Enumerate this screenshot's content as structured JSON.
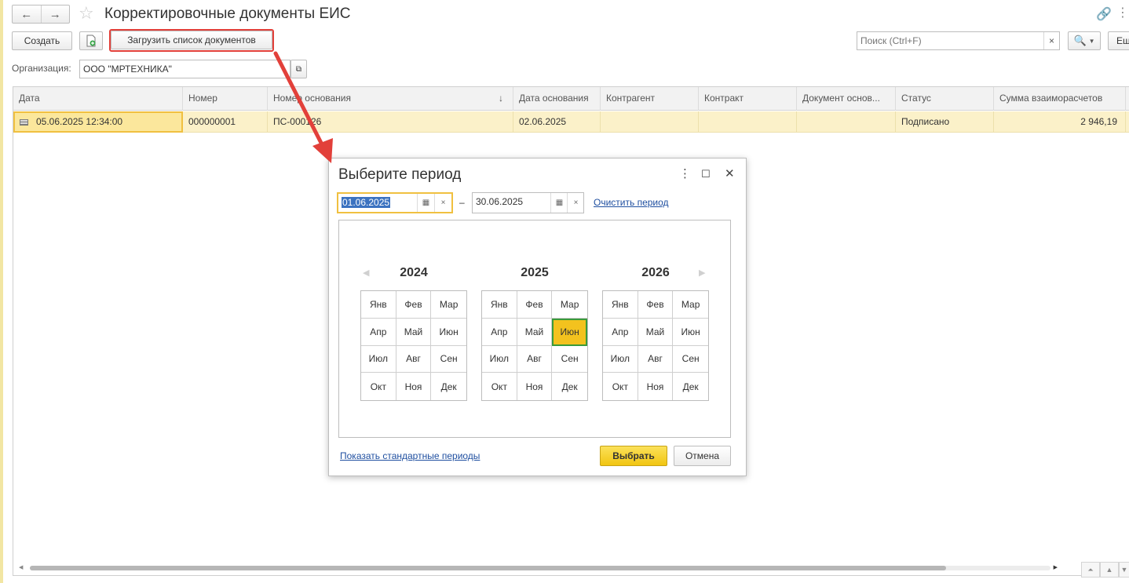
{
  "window": {
    "title": "Корректировочные документы ЕИС",
    "nav_back_icon": "arrow-left-icon",
    "nav_forward_icon": "arrow-right-icon"
  },
  "toolbar": {
    "create_label": "Создать",
    "load_list_label": "Загрузить список документов",
    "search_placeholder": "Поиск (Ctrl+F)",
    "more_label": "Ещ"
  },
  "filter": {
    "org_label": "Организация:",
    "org_value": "ООО \"МРТЕХНИКА\""
  },
  "table": {
    "columns": [
      "Дата",
      "Номер",
      "Номер основания",
      "Дата основания",
      "Контрагент",
      "Контракт",
      "Документ основ...",
      "Статус",
      "Сумма взаиморасчетов"
    ],
    "sort_indicator": "↓",
    "rows": [
      {
        "date": "05.06.2025 12:34:00",
        "number": "000000001",
        "base_number": "ПС-000126",
        "base_date": "02.06.2025",
        "counterparty": "",
        "contract": "",
        "base_document": "",
        "status": "Подписано",
        "amount": "2 946,19"
      }
    ]
  },
  "dialog": {
    "title": "Выберите период",
    "date_from": "01.06.2025",
    "date_to": "30.06.2025",
    "dash": "–",
    "clear_period_label": "Очистить период",
    "years": [
      "2024",
      "2025",
      "2026"
    ],
    "months": [
      "Янв",
      "Фев",
      "Мар",
      "Апр",
      "Май",
      "Июн",
      "Июл",
      "Авг",
      "Сен",
      "Окт",
      "Ноя",
      "Дек"
    ],
    "selected_year": "2025",
    "selected_month": "Июн",
    "show_standard_label": "Показать стандартные периоды",
    "select_label": "Выбрать",
    "cancel_label": "Отмена"
  },
  "colors": {
    "accent_yellow": "#f3c21e",
    "highlight_red": "#e2403a",
    "row_selected": "#fbf1c9",
    "link_blue": "#1f4fa0"
  }
}
